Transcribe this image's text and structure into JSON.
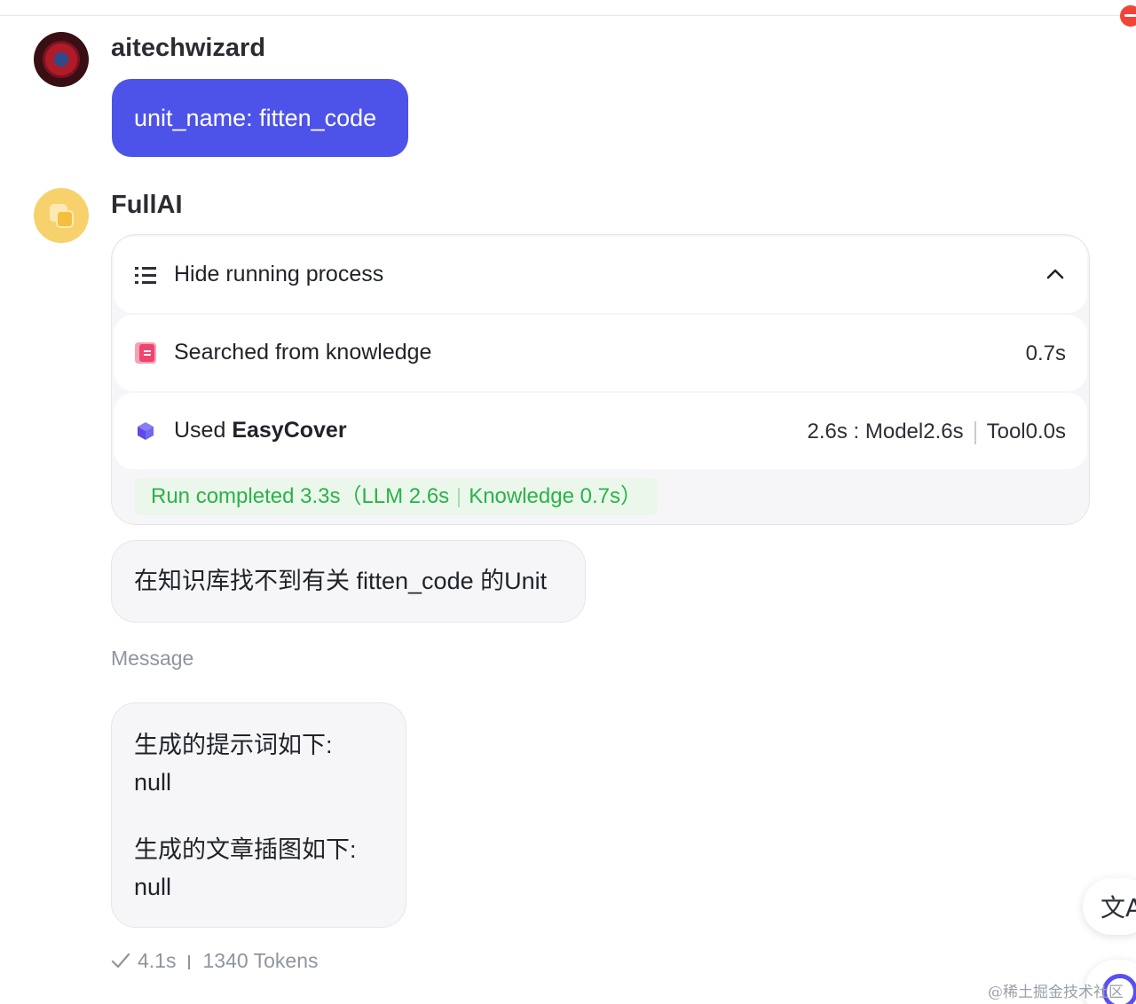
{
  "user_message": {
    "author": "aitechwizard",
    "text": "unit_name: fitten_code"
  },
  "bot": {
    "name": "FullAI",
    "process": {
      "toggle_label": "Hide running process",
      "steps": [
        {
          "label": "Searched from knowledge",
          "time": "0.7s"
        },
        {
          "label_prefix": "Used ",
          "label_strong": "EasyCover",
          "time": "2.6s : Model2.6s",
          "tool_time": "Tool0.0s"
        }
      ],
      "status": {
        "main": "Run completed 3.3s（LLM 2.6s",
        "knowledge": "Knowledge 0.7s）"
      }
    },
    "reply": "在知识库找不到有关 fitten_code 的Unit",
    "message_label": "Message",
    "message": {
      "line1": "生成的提示词如下:",
      "line2": "null",
      "line3": "生成的文章插图如下:",
      "line4": "null"
    },
    "footer": {
      "duration": "4.1s",
      "tokens": "1340 Tokens"
    }
  },
  "floating": {
    "translate_glyph": "文A"
  },
  "watermark": "@稀土掘金技术社区",
  "colors": {
    "accent": "#4d53e8",
    "success": "#2bb24a",
    "close": "#f04438"
  }
}
